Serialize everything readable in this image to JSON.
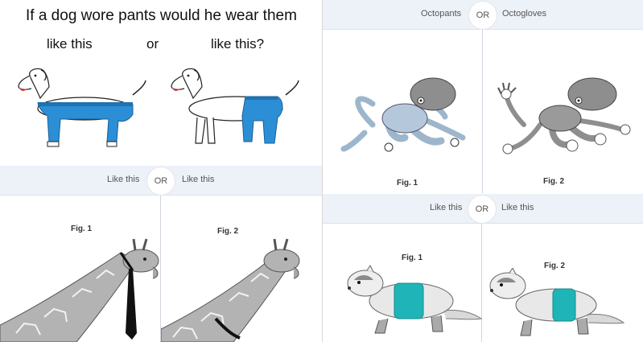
{
  "dog": {
    "title": "If a dog wore pants would he wear them",
    "left": "like this",
    "or": "or",
    "right": "like this?"
  },
  "octopus": {
    "left": "Octopants",
    "or": "OR",
    "right": "Octogloves",
    "fig1": "Fig. 1",
    "fig2": "Fig. 2"
  },
  "giraffe": {
    "left": "Like this",
    "or": "OR",
    "right": "Like this",
    "fig1": "Fig. 1",
    "fig2": "Fig. 2"
  },
  "ferret": {
    "left": "Like this",
    "or": "OR",
    "right": "Like this",
    "fig1": "Fig. 1",
    "fig2": "Fig. 2"
  },
  "colors": {
    "pants_blue": "#2c8fd6",
    "shirt_teal": "#1fb5b8",
    "octopus_grey": "#8e8e8e",
    "octopants_blue": "#9db6cc",
    "header_bg": "#edf1f8"
  }
}
